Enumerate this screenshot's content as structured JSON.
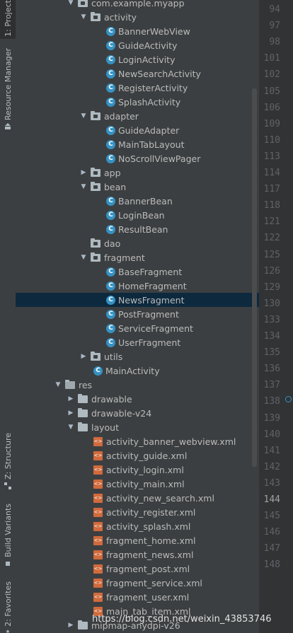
{
  "sidebar": {
    "tabs": [
      {
        "label": "1: Project",
        "icon": "folder-icon"
      },
      {
        "label": "Resource Manager",
        "icon": "resource-icon"
      },
      {
        "label": "Z: Structure",
        "icon": "structure-icon"
      },
      {
        "label": "Build Variants",
        "icon": "build-icon"
      },
      {
        "label": "2: Favorites",
        "icon": "star-icon"
      }
    ]
  },
  "tree": {
    "items": [
      {
        "label": "com.example.myapp",
        "kind": "package",
        "open": true
      },
      {
        "label": "activity",
        "kind": "package",
        "open": true
      },
      {
        "label": "BannerWebView",
        "kind": "class"
      },
      {
        "label": "GuideActivity",
        "kind": "class"
      },
      {
        "label": "LoginActivity",
        "kind": "class"
      },
      {
        "label": "NewSearchActivity",
        "kind": "class"
      },
      {
        "label": "RegisterActivity",
        "kind": "class"
      },
      {
        "label": "SplashActivity",
        "kind": "class"
      },
      {
        "label": "adapter",
        "kind": "package",
        "open": true
      },
      {
        "label": "GuideAdapter",
        "kind": "class"
      },
      {
        "label": "MainTabLayout",
        "kind": "class"
      },
      {
        "label": "NoScrollViewPager",
        "kind": "class"
      },
      {
        "label": "app",
        "kind": "package",
        "open": false
      },
      {
        "label": "bean",
        "kind": "package",
        "open": true
      },
      {
        "label": "BannerBean",
        "kind": "class"
      },
      {
        "label": "LoginBean",
        "kind": "class"
      },
      {
        "label": "ResultBean",
        "kind": "class"
      },
      {
        "label": "dao",
        "kind": "package"
      },
      {
        "label": "fragment",
        "kind": "package",
        "open": true
      },
      {
        "label": "BaseFragment",
        "kind": "class"
      },
      {
        "label": "HomeFragment",
        "kind": "class"
      },
      {
        "label": "NewsFragment",
        "kind": "class",
        "selected": true
      },
      {
        "label": "PostFragment",
        "kind": "class"
      },
      {
        "label": "ServiceFragment",
        "kind": "class"
      },
      {
        "label": "UserFragment",
        "kind": "class"
      },
      {
        "label": "utils",
        "kind": "package",
        "open": false
      },
      {
        "label": "MainActivity",
        "kind": "class"
      },
      {
        "label": "res",
        "kind": "res",
        "open": true
      },
      {
        "label": "drawable",
        "kind": "folder",
        "open": false
      },
      {
        "label": "drawable-v24",
        "kind": "folder",
        "open": false
      },
      {
        "label": "layout",
        "kind": "folder",
        "open": true
      },
      {
        "label": "activity_banner_webview.xml",
        "kind": "xml"
      },
      {
        "label": "activity_guide.xml",
        "kind": "xml"
      },
      {
        "label": "activity_login.xml",
        "kind": "xml"
      },
      {
        "label": "activity_main.xml",
        "kind": "xml"
      },
      {
        "label": "activity_new_search.xml",
        "kind": "xml"
      },
      {
        "label": "activity_register.xml",
        "kind": "xml"
      },
      {
        "label": "activity_splash.xml",
        "kind": "xml"
      },
      {
        "label": "fragment_home.xml",
        "kind": "xml"
      },
      {
        "label": "fragment_news.xml",
        "kind": "xml"
      },
      {
        "label": "fragment_post.xml",
        "kind": "xml"
      },
      {
        "label": "fragment_service.xml",
        "kind": "xml"
      },
      {
        "label": "fragment_user.xml",
        "kind": "xml"
      },
      {
        "label": "main_tab_item.xml",
        "kind": "xml"
      },
      {
        "label": "mipmap-anydpi-v26",
        "kind": "folder",
        "open": false
      }
    ]
  },
  "gutter": {
    "line_numbers": [
      "94",
      "97",
      "98",
      "101",
      "102",
      "105",
      "106",
      "109",
      "110",
      "113",
      "114",
      "117",
      "118",
      "121",
      "122",
      "125",
      "126",
      "129",
      "130",
      "133",
      "134",
      "135",
      "136",
      "137",
      "138",
      "139",
      "140",
      "141",
      "142",
      "143",
      "144",
      "145",
      "146",
      "147",
      "148"
    ],
    "current_line": "144"
  },
  "watermark": "https://blog.csdn.net/weixin_43853746",
  "colors": {
    "accent": "#3592c4",
    "selection": "#0d293e",
    "xml": "#d06a3c"
  }
}
